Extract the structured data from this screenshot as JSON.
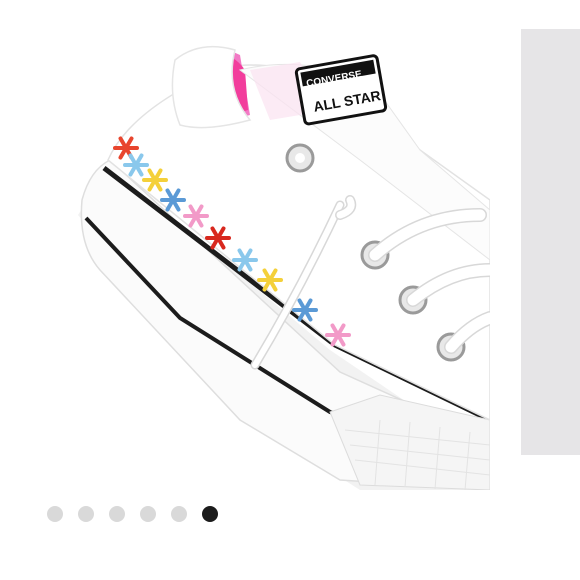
{
  "product_image": {
    "heel_label_brand": "CONVERSE",
    "heel_label_line": "ALL STAR"
  },
  "carousel": {
    "slide_count": 6,
    "active_index": 5
  },
  "colors": {
    "canvas": "#ffffff",
    "collar_pink": "#f27ac5",
    "sole_stripe": "#1c1c1c",
    "dot_inactive": "#d9d9d9",
    "dot_active": "#1c1c1c",
    "next_peek": "#e6e5e7"
  },
  "flower_colors": [
    "#e8452e",
    "#8ac8ec",
    "#f4d03a",
    "#5b9ad6",
    "#f29ac8",
    "#d8281e",
    "#8ac8ec",
    "#f4d03a",
    "#5b9ad6",
    "#f29ac8"
  ]
}
